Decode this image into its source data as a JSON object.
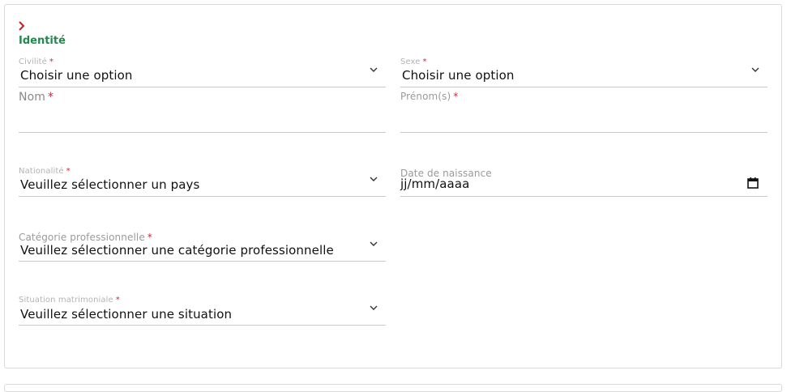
{
  "section": {
    "title": "Identité",
    "toggle_icon": "chevron-right-icon"
  },
  "required_marker": "*",
  "fields": {
    "civilite": {
      "label": "Civilité",
      "value": "Choisir une option"
    },
    "sexe": {
      "label": "Sexe",
      "value": "Choisir une option"
    },
    "nom": {
      "label": "Nom",
      "value": ""
    },
    "prenom": {
      "label": "Prénom(s)",
      "value": ""
    },
    "nationalite": {
      "label": "Nationalité",
      "value": "Veuillez sélectionner un pays"
    },
    "date_naissance": {
      "label": "Date de naissance",
      "value": "jj/mm/aaaa"
    },
    "categorie": {
      "label": "Catégorie professionnelle",
      "value": "Veuillez sélectionner une catégorie professionnelle"
    },
    "situation": {
      "label": "Situation matrimoniale",
      "value": "Veuillez sélectionner une situation"
    }
  },
  "colors": {
    "accent_green": "#1f8a4c",
    "required_red": "#d6243a",
    "toggle_red": "#c0202a"
  }
}
